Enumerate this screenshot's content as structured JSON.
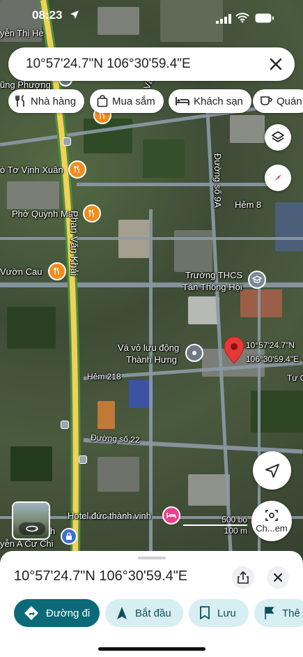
{
  "status_bar": {
    "time": "08:23"
  },
  "search": {
    "query": "10°57'24.7\"N 106°30'59.4\"E"
  },
  "chips": [
    {
      "label": "Nhà hàng",
      "icon": "fork-knife-icon"
    },
    {
      "label": "Mua sắm",
      "icon": "shopping-bag-icon"
    },
    {
      "label": "Khách sạn",
      "icon": "bed-icon"
    },
    {
      "label": "Quán",
      "icon": "cup-icon"
    }
  ],
  "map": {
    "labels": {
      "nguyen_thi_he": "yễn Thị Hè",
      "dung_phuong": "ũng Phượng",
      "tran_van": "Trần Vă",
      "to_vinh_xuan": "ò Tơ Vịnh Xuân",
      "duong_so_9a": "Đường số 9A",
      "hem_8": "Hẻm 8",
      "pho_quynh_mai": "Phở Quỳnh Mai",
      "phan_van_khai": "Phan Văn Khải",
      "vuon_cau": "Vườn Cau",
      "truong_thcs_1": "Trường THCS",
      "truong_thcs_2": "Tân Thông Hội",
      "va_vo_1": "Vá vỏ lưu động",
      "va_vo_2": "Thành Hưng",
      "pin_coord_1": "10°57'24.7\"N",
      "pin_coord_2": "106°30'59.4\"E",
      "tu_c": "Tư C",
      "hem_218": "Hẻm 218",
      "duong_so_22": "Đường số 22",
      "hotel": "Hotel đức thành vinh",
      "nguyen_a_cu_chi": "yễn A Cư Chi",
      "h_label": "h"
    },
    "scale": {
      "top": "500 bộ",
      "bottom": "100 m"
    },
    "screenshot_button": "Ch...em"
  },
  "sheet": {
    "title": "10°57'24.7\"N 106°30'59.4\"E",
    "actions": [
      {
        "label": "Đường đi",
        "icon": "directions-icon"
      },
      {
        "label": "Bắt đầu",
        "icon": "navigation-arrow-icon"
      },
      {
        "label": "Lưu",
        "icon": "bookmark-icon"
      },
      {
        "label": "Thê",
        "icon": "flag-icon"
      }
    ]
  },
  "colors": {
    "accent": "#0b6a78",
    "secondary_pill": "#d7eef2",
    "pin": "#e53935",
    "highway": "#f2d15a",
    "food_poi": "#f28c1c",
    "hotel_poi": "#e8428f"
  }
}
